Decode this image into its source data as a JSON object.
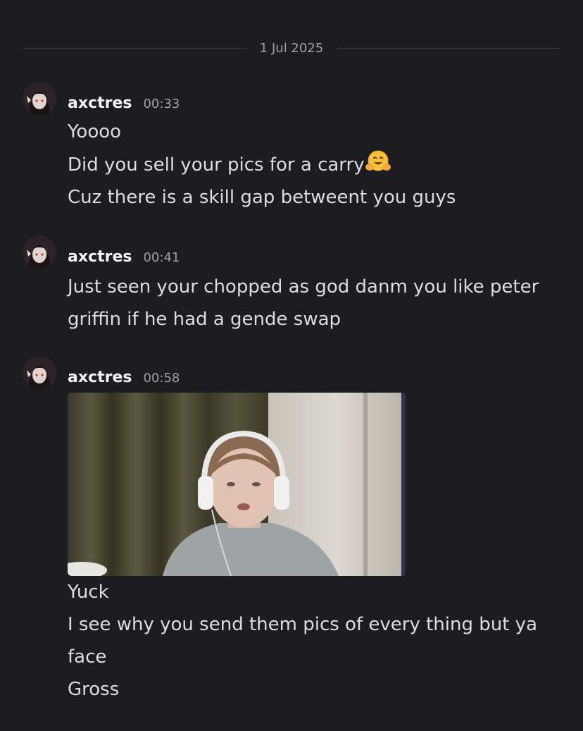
{
  "date_divider": {
    "label": "1 Jul 2025"
  },
  "messages": [
    {
      "username": "axctres",
      "time": "00:33",
      "lines": [
        "Yoooo",
        "Did you sell your pics for a carry",
        "Cuz there is a skill gap betweent you guys"
      ],
      "emoji_after_line_2": "hugging-face-icon"
    },
    {
      "username": "axctres",
      "time": "00:41",
      "lines": [
        "Just seen your chopped as god danm you like peter",
        "griffin if he had a gende swap"
      ]
    },
    {
      "username": "axctres",
      "time": "00:58",
      "attachment": "image-attachment",
      "lines": [
        "Yuck",
        "I see why you send them pics of every thing but ya",
        "face",
        "Gross"
      ]
    }
  ],
  "colors": {
    "background": "#1c1c21",
    "text": "#dcdde1",
    "username": "#f2f3f5",
    "muted": "#9ea0a8"
  }
}
